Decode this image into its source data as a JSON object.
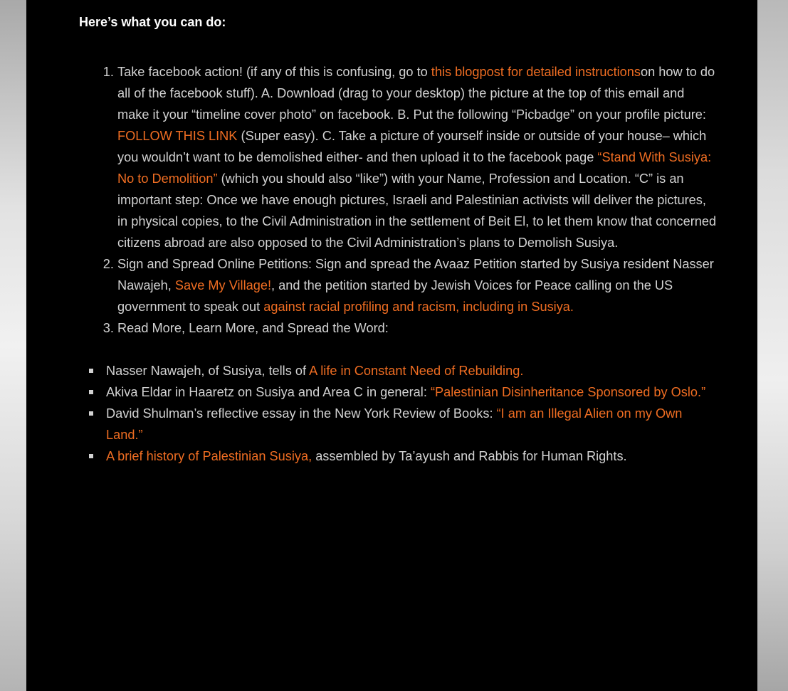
{
  "heading": "Here’s what you can do:",
  "step1": {
    "t1": "Take facebook action! (if any of this is confusing, go to ",
    "link1": "this blogpost for detailed instructions",
    "t2": "on how to do all of the facebook stuff).  A. Download (drag to your desktop) the picture at the top of this email and make it your “timeline cover photo” on facebook.   B. Put the following “Picbadge” on your profile picture: ",
    "link2": "FOLLOW THIS LINK",
    "t3": " (Super easy).  C. Take a picture of yourself inside or outside of your house– which you wouldn’t want to be demolished either- and then upload it to the facebook page ",
    "link3": "“Stand With Susiya: No to Demolition”",
    "t4": " (which you should also “like”) with your Name, Profession and Location. “C” is an important step: Once we have enough pictures, Israeli and Palestinian activists will deliver the pictures, in physical copies, to the Civil Administration in the settlement of Beit El, to let them know that concerned citizens abroad are also opposed to the Civil Administration’s plans to Demolish Susiya."
  },
  "step2": {
    "t1": "Sign and Spread Online Petitions: Sign and spread the Avaaz Petition started by Susiya resident Nasser Nawajeh, ",
    "link1": "Save My Village!",
    "t2": ", and the petition started by Jewish Voices for Peace calling on the US government to speak out ",
    "link2": "against racial profiling and racism, including in Susiya."
  },
  "step3": {
    "t1": "Read More, Learn More, and Spread the Word:"
  },
  "resources": {
    "r1_text": "Nasser Nawajeh, of Susiya, tells of ",
    "r1_link": "A life in Constant Need of Rebuilding.",
    "r2_text": "Akiva Eldar in Haaretz on Susiya and Area C in general: ",
    "r2_link": "“Palestinian Disinheritance Sponsored by Oslo.”",
    "r3_text": "David Shulman’s reflective essay in the New York Review of Books: ",
    "r3_link": "“I am an Illegal Alien on my Own Land.”",
    "r4_link": "A brief history of Palestinian Susiya,",
    "r4_text": " assembled by Ta’ayush and Rabbis for Human Rights."
  },
  "colors": {
    "panel_bg": "#000000",
    "body_text": "#d2d2d2",
    "link": "#ef6d22",
    "heading": "#ffffff"
  }
}
